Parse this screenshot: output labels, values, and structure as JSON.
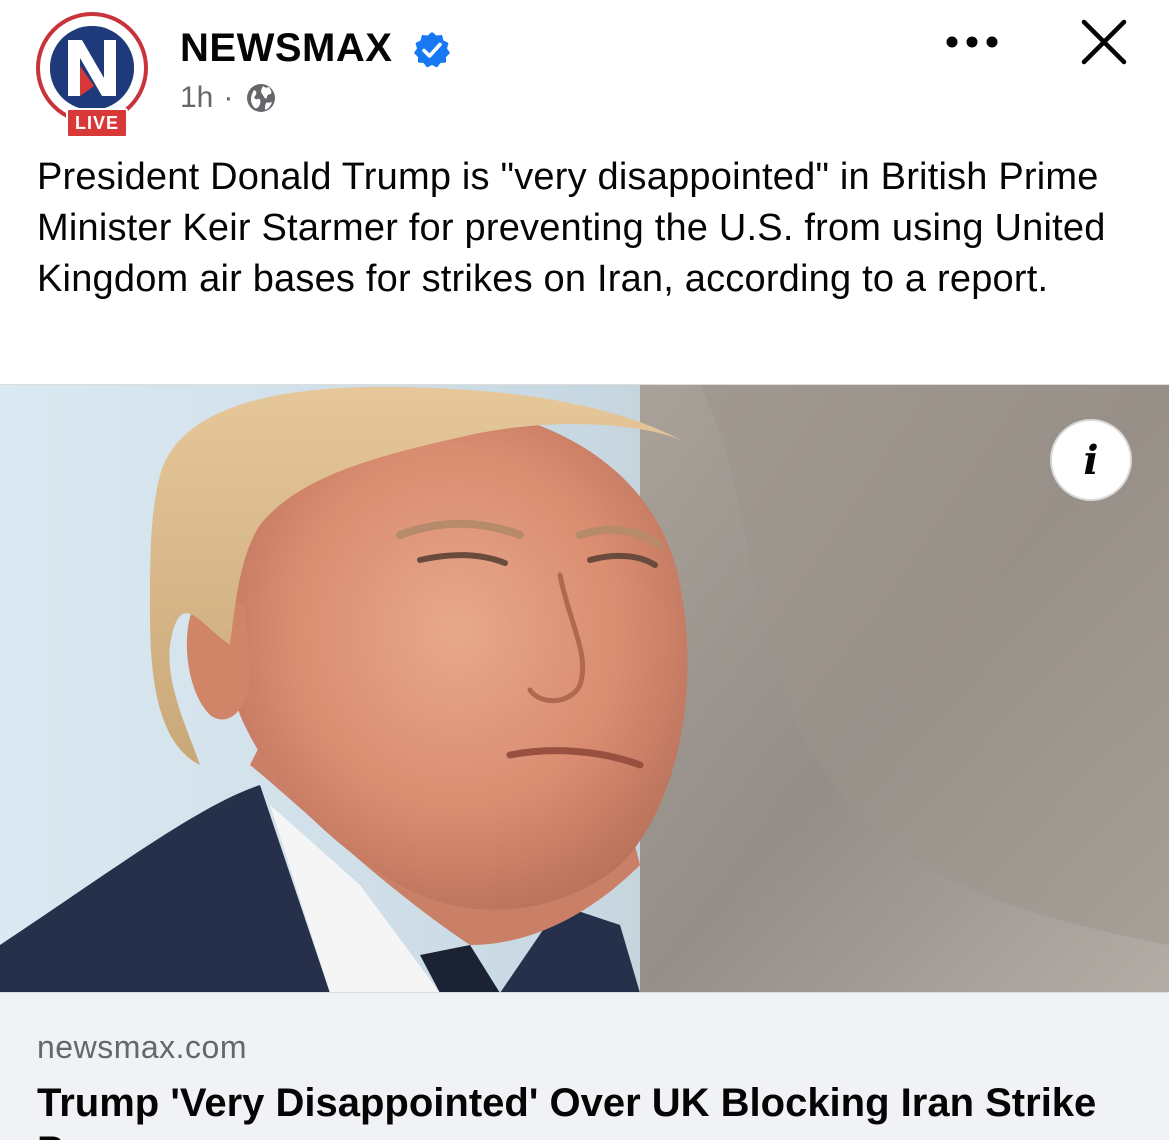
{
  "post": {
    "page_name": "NEWSMAX",
    "live_label": "LIVE",
    "timestamp": "1h",
    "separator": "·",
    "audience_icon": "globe-icon",
    "verified_icon": "verified-badge-icon",
    "more_icon": "more-options-icon",
    "close_icon": "close-icon",
    "caption": "President Donald Trump is \"very disappointed\" in British Prime Minister Keir Starmer for preventing the U.S. from using United Kingdom air bases for strikes on Iran, according to a report.",
    "image_info_label": "i"
  },
  "link": {
    "domain": "newsmax.com",
    "title": "Trump 'Very Disappointed' Over UK Blocking Iran Strike P..."
  },
  "colors": {
    "brand_red": "#c9343a",
    "brand_blue": "#1f3a7a",
    "verified_blue": "#1877f2",
    "meta_gray": "#65676b",
    "preview_bg": "#f0f2f5"
  }
}
